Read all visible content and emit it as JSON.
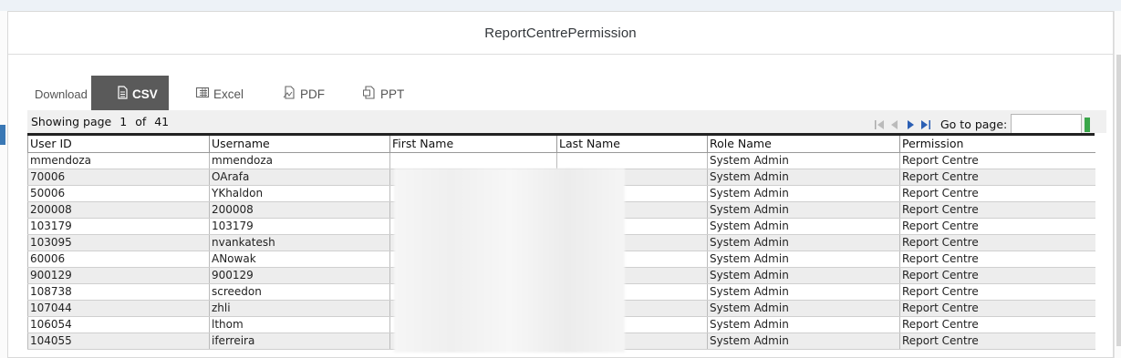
{
  "dialog": {
    "title": "ReportCentrePermission"
  },
  "toolbar": {
    "download_label": "Download",
    "buttons": [
      {
        "label": "CSV",
        "icon": "csv-file-icon",
        "active": true
      },
      {
        "label": "Excel",
        "icon": "excel-file-icon",
        "active": false
      },
      {
        "label": "PDF",
        "icon": "pdf-file-icon",
        "active": false
      },
      {
        "label": "PPT",
        "icon": "ppt-file-icon",
        "active": false
      }
    ]
  },
  "pager": {
    "showing_label": "Showing page",
    "current_page": "1",
    "of_label": "of",
    "total_pages": "41",
    "goto_label": "Go to page:",
    "goto_value": ""
  },
  "table": {
    "columns": [
      "User ID",
      "Username",
      "First Name",
      "Last Name",
      "Role Name",
      "Permission"
    ],
    "rows": [
      [
        "mmendoza",
        "mmendoza",
        "",
        "",
        "System Admin",
        "Report Centre"
      ],
      [
        "70006",
        "OArafa",
        "",
        "",
        "System Admin",
        "Report Centre"
      ],
      [
        "50006",
        "YKhaldon",
        "",
        "",
        "System Admin",
        "Report Centre"
      ],
      [
        "200008",
        "200008",
        "",
        "",
        "System Admin",
        "Report Centre"
      ],
      [
        "103179",
        "103179",
        "",
        "",
        "System Admin",
        "Report Centre"
      ],
      [
        "103095",
        "nvankatesh",
        "",
        "",
        "System Admin",
        "Report Centre"
      ],
      [
        "60006",
        "ANowak",
        "",
        "",
        "System Admin",
        "Report Centre"
      ],
      [
        "900129",
        "900129",
        "",
        "",
        "System Admin",
        "Report Centre"
      ],
      [
        "108738",
        "screedon",
        "",
        "",
        "System Admin",
        "Report Centre"
      ],
      [
        "107044",
        "zhli",
        "",
        "",
        "System Admin",
        "Report Centre"
      ],
      [
        "106054",
        "lthom",
        "",
        "",
        "System Admin",
        "Report Centre"
      ],
      [
        "104055",
        "iferreira",
        "",
        "",
        "System Admin",
        "Report Centre"
      ]
    ]
  },
  "colors": {
    "active_button": "#5a5a5a",
    "pager_arrow": "#2b5fb4",
    "go_button": "#3aa64a"
  }
}
